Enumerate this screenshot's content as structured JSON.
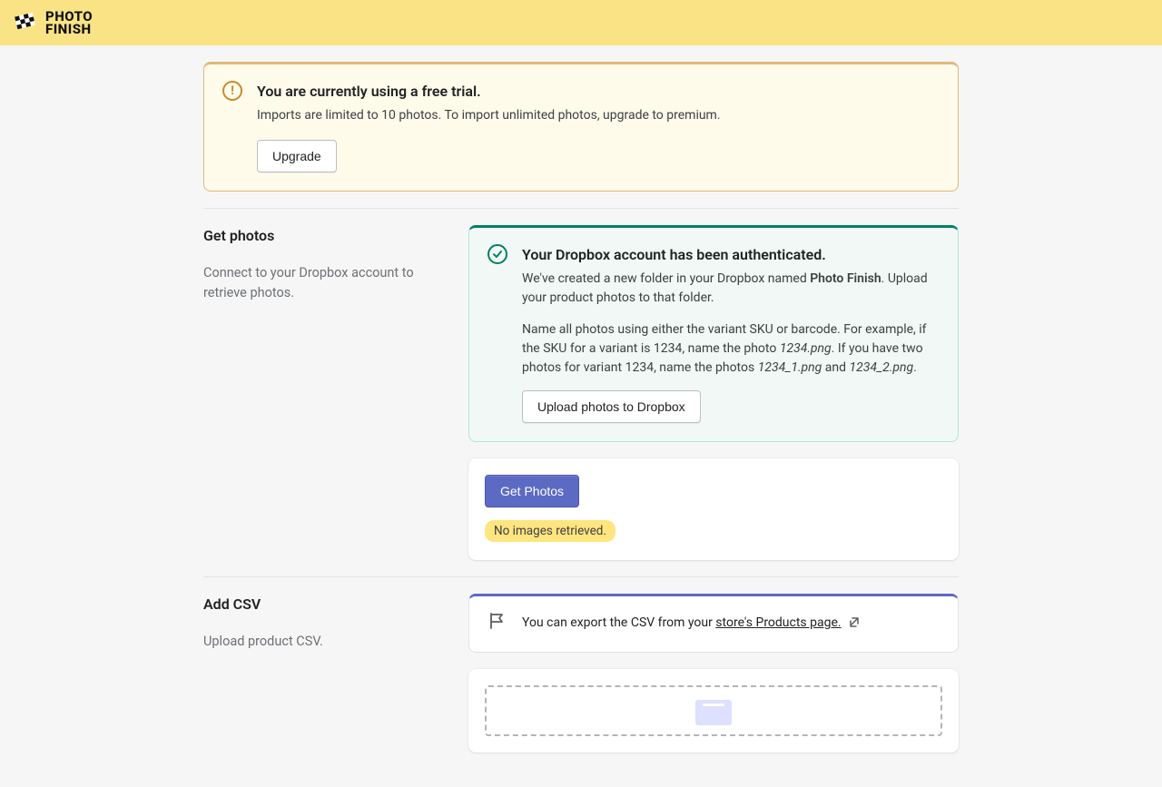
{
  "brand": {
    "line1": "PHOTO",
    "line2": "FINISH"
  },
  "trial_banner": {
    "title": "You are currently using a free trial.",
    "desc": "Imports are limited to 10 photos. To import unlimited photos, upgrade to premium.",
    "button": "Upgrade"
  },
  "get_photos": {
    "title": "Get photos",
    "desc": "Connect to your Dropbox account to retrieve photos.",
    "success_title": "Your Dropbox account has been authenticated.",
    "success_p1_a": "We've created a new folder in your Dropbox named ",
    "success_p1_strong": "Photo Finish",
    "success_p1_b": ". Upload your product photos to that folder.",
    "success_p2_a": "Name all photos using either the variant SKU or barcode. For example, if the SKU for a variant is 1234, name the photo ",
    "success_p2_f1": "1234.png",
    "success_p2_b": ". If you have two photos for variant 1234, name the photos ",
    "success_p2_f2": "1234_1.png",
    "success_p2_and": " and ",
    "success_p2_f3": "1234_2.png",
    "success_p2_c": ".",
    "upload_btn": "Upload photos to Dropbox",
    "get_btn": "Get Photos",
    "status": "No images retrieved."
  },
  "add_csv": {
    "title": "Add CSV",
    "desc": "Upload product CSV.",
    "info_a": "You can export the CSV from your ",
    "info_link": "store's Products page."
  }
}
